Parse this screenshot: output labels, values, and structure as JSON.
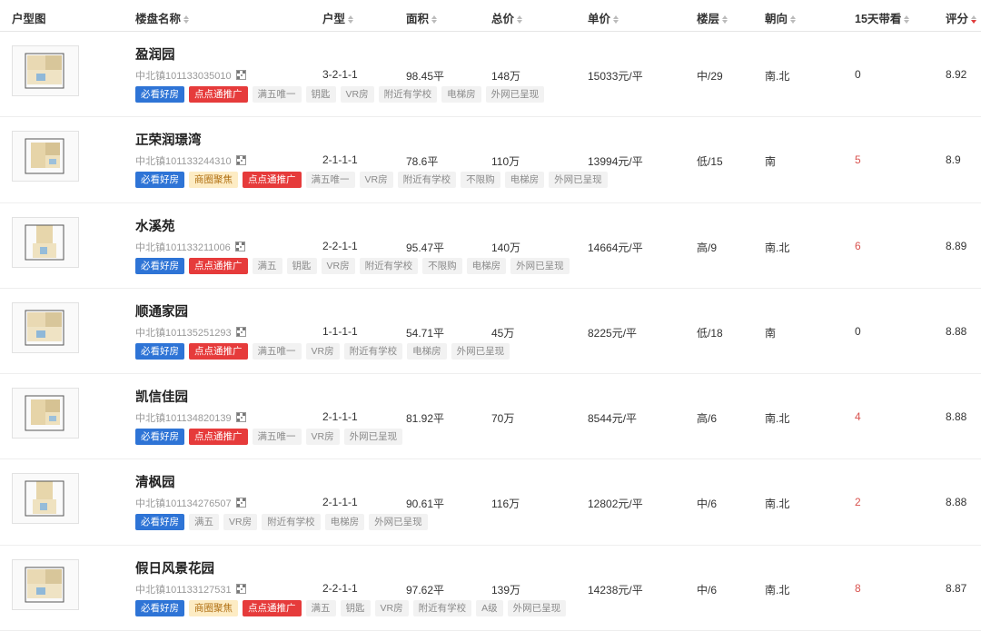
{
  "headers": [
    {
      "key": "thumb",
      "label": "户型图",
      "sort": false
    },
    {
      "key": "name",
      "label": "楼盘名称",
      "sort": true
    },
    {
      "key": "type",
      "label": "户型",
      "sort": true
    },
    {
      "key": "area",
      "label": "面积",
      "sort": true
    },
    {
      "key": "total",
      "label": "总价",
      "sort": true
    },
    {
      "key": "unit",
      "label": "单价",
      "sort": true
    },
    {
      "key": "floor",
      "label": "楼层",
      "sort": true
    },
    {
      "key": "dir",
      "label": "朝向",
      "sort": true
    },
    {
      "key": "view",
      "label": "15天带看",
      "sort": true
    },
    {
      "key": "score",
      "label": "评分",
      "sort": true,
      "active": true
    }
  ],
  "colors": {
    "blue_tag": "#2e74d6",
    "red_tag": "#e63b3b",
    "yellow_tag": "#fdecc4",
    "hot_number": "#d9534f"
  },
  "rows": [
    {
      "name": "盈润园",
      "code": "中北镇101133035010",
      "type": "3-2-1-1",
      "area": "98.45平",
      "total": "148万",
      "unit": "15033元/平",
      "floor": "中/29",
      "dir": "南.北",
      "view": "0",
      "hot": false,
      "score": "8.92",
      "tags": [
        {
          "t": "必看好房",
          "c": "blue"
        },
        {
          "t": "点点通推广",
          "c": "red"
        },
        {
          "t": "满五唯一",
          "c": "gray"
        },
        {
          "t": "钥匙",
          "c": "gray"
        },
        {
          "t": "VR房",
          "c": "gray"
        },
        {
          "t": "附近有学校",
          "c": "gray"
        },
        {
          "t": "电梯房",
          "c": "gray"
        },
        {
          "t": "外网已呈现",
          "c": "gray"
        }
      ]
    },
    {
      "name": "正荣润璟湾",
      "code": "中北镇101133244310",
      "type": "2-1-1-1",
      "area": "78.6平",
      "total": "110万",
      "unit": "13994元/平",
      "floor": "低/15",
      "dir": "南",
      "view": "5",
      "hot": true,
      "score": "8.9",
      "tags": [
        {
          "t": "必看好房",
          "c": "blue"
        },
        {
          "t": "商圈聚焦",
          "c": "yellow"
        },
        {
          "t": "点点通推广",
          "c": "red"
        },
        {
          "t": "满五唯一",
          "c": "gray"
        },
        {
          "t": "VR房",
          "c": "gray"
        },
        {
          "t": "附近有学校",
          "c": "gray"
        },
        {
          "t": "不限购",
          "c": "gray"
        },
        {
          "t": "电梯房",
          "c": "gray"
        },
        {
          "t": "外网已呈现",
          "c": "gray"
        }
      ]
    },
    {
      "name": "水溪苑",
      "code": "中北镇101133211006",
      "type": "2-2-1-1",
      "area": "95.47平",
      "total": "140万",
      "unit": "14664元/平",
      "floor": "高/9",
      "dir": "南.北",
      "view": "6",
      "hot": true,
      "score": "8.89",
      "tags": [
        {
          "t": "必看好房",
          "c": "blue"
        },
        {
          "t": "点点通推广",
          "c": "red"
        },
        {
          "t": "满五",
          "c": "gray"
        },
        {
          "t": "钥匙",
          "c": "gray"
        },
        {
          "t": "VR房",
          "c": "gray"
        },
        {
          "t": "附近有学校",
          "c": "gray"
        },
        {
          "t": "不限购",
          "c": "gray"
        },
        {
          "t": "电梯房",
          "c": "gray"
        },
        {
          "t": "外网已呈现",
          "c": "gray"
        }
      ]
    },
    {
      "name": "顺通家园",
      "code": "中北镇101135251293",
      "type": "1-1-1-1",
      "area": "54.71平",
      "total": "45万",
      "unit": "8225元/平",
      "floor": "低/18",
      "dir": "南",
      "view": "0",
      "hot": false,
      "score": "8.88",
      "tags": [
        {
          "t": "必看好房",
          "c": "blue"
        },
        {
          "t": "点点通推广",
          "c": "red"
        },
        {
          "t": "满五唯一",
          "c": "gray"
        },
        {
          "t": "VR房",
          "c": "gray"
        },
        {
          "t": "附近有学校",
          "c": "gray"
        },
        {
          "t": "电梯房",
          "c": "gray"
        },
        {
          "t": "外网已呈现",
          "c": "gray"
        }
      ]
    },
    {
      "name": "凯信佳园",
      "code": "中北镇101134820139",
      "type": "2-1-1-1",
      "area": "81.92平",
      "total": "70万",
      "unit": "8544元/平",
      "floor": "高/6",
      "dir": "南.北",
      "view": "4",
      "hot": true,
      "score": "8.88",
      "tags": [
        {
          "t": "必看好房",
          "c": "blue"
        },
        {
          "t": "点点通推广",
          "c": "red"
        },
        {
          "t": "满五唯一",
          "c": "gray"
        },
        {
          "t": "VR房",
          "c": "gray"
        },
        {
          "t": "外网已呈现",
          "c": "gray"
        }
      ]
    },
    {
      "name": "清枫园",
      "code": "中北镇101134276507",
      "type": "2-1-1-1",
      "area": "90.61平",
      "total": "116万",
      "unit": "12802元/平",
      "floor": "中/6",
      "dir": "南.北",
      "view": "2",
      "hot": true,
      "score": "8.88",
      "tags": [
        {
          "t": "必看好房",
          "c": "blue"
        },
        {
          "t": "满五",
          "c": "gray"
        },
        {
          "t": "VR房",
          "c": "gray"
        },
        {
          "t": "附近有学校",
          "c": "gray"
        },
        {
          "t": "电梯房",
          "c": "gray"
        },
        {
          "t": "外网已呈现",
          "c": "gray"
        }
      ]
    },
    {
      "name": "假日风景花园",
      "code": "中北镇101133127531",
      "type": "2-2-1-1",
      "area": "97.62平",
      "total": "139万",
      "unit": "14238元/平",
      "floor": "中/6",
      "dir": "南.北",
      "view": "8",
      "hot": true,
      "score": "8.87",
      "tags": [
        {
          "t": "必看好房",
          "c": "blue"
        },
        {
          "t": "商圈聚焦",
          "c": "yellow"
        },
        {
          "t": "点点通推广",
          "c": "red"
        },
        {
          "t": "满五",
          "c": "gray"
        },
        {
          "t": "钥匙",
          "c": "gray"
        },
        {
          "t": "VR房",
          "c": "gray"
        },
        {
          "t": "附近有学校",
          "c": "gray"
        },
        {
          "t": "A级",
          "c": "gray"
        },
        {
          "t": "外网已呈现",
          "c": "gray"
        }
      ]
    }
  ]
}
